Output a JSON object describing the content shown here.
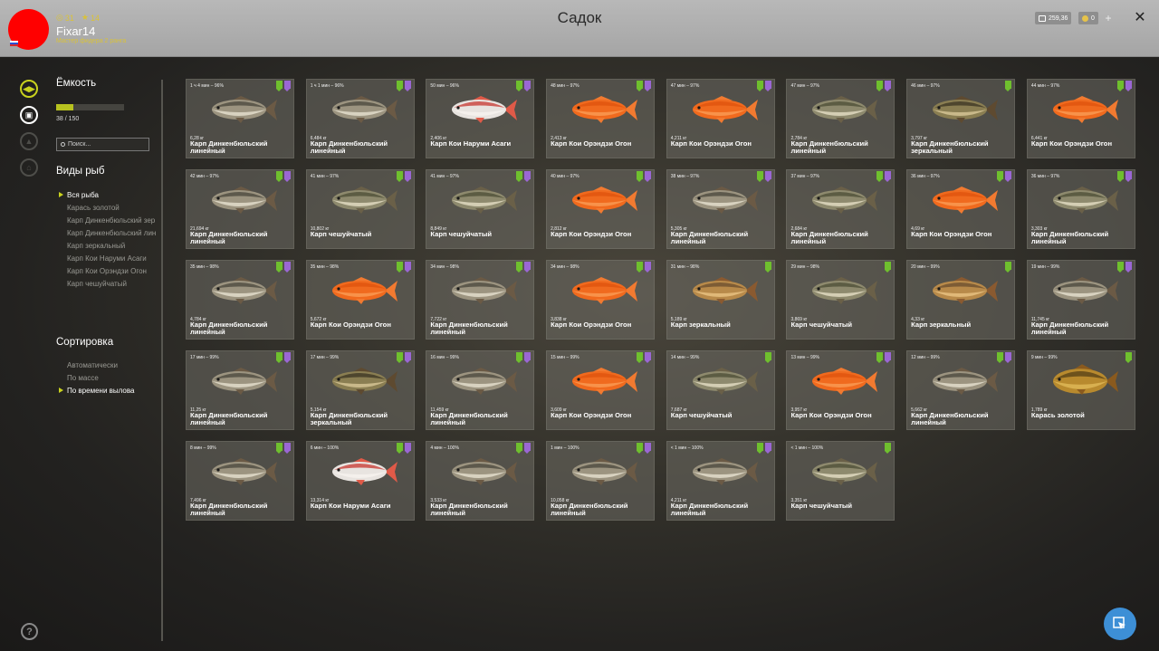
{
  "header": {
    "title": "Садок",
    "stat_coins": "31",
    "stat_stars": "14",
    "username": "Fixar14",
    "user_title": "Мастер фидера 2 ранга",
    "money": "259,36",
    "gold": "0",
    "plus": "+",
    "close": "✕"
  },
  "sidebar": {
    "capacity_label": "Ёмкость",
    "capacity_text": "38 / 150",
    "capacity_fraction": 0.253,
    "search_placeholder": "Поиск...",
    "species_label": "Виды рыб",
    "species": [
      "Вся рыба",
      "Карась золотой",
      "Карп Динкенбюльский зер",
      "Карп Динкенбюльский лин",
      "Карп зеркальный",
      "Карп Кои Наруми Асаги",
      "Карп Кои Орэндзи Огон",
      "Карп чешуйчатый"
    ],
    "species_selected": 0,
    "sort_label": "Сортировка",
    "sort_options": [
      "Автоматически",
      "По массе",
      "По времени вылова"
    ],
    "sort_selected": 2
  },
  "colors": {
    "accent": "#c9d21e",
    "badge_green": "#6fbf2e",
    "badge_purple": "#9a67d4"
  },
  "fish": [
    {
      "time": "1 ч 4 мин – 96%",
      "weight": "6,28 кг",
      "name": "Карп Динкенбюльский линейный",
      "type": "carp",
      "badges": [
        "g",
        "p"
      ]
    },
    {
      "time": "1 ч 1 мин – 96%",
      "weight": "6,484 кг",
      "name": "Карп Динкенбюльский линейный",
      "type": "carp",
      "badges": [
        "g",
        "p"
      ]
    },
    {
      "time": "50 мин – 96%",
      "weight": "2,406 кг",
      "name": "Карп Кои Наруми Асаги",
      "type": "koi_asagi",
      "badges": [
        "g",
        "p"
      ]
    },
    {
      "time": "48 мин – 97%",
      "weight": "2,413 кг",
      "name": "Карп Кои Орэндзи Огон",
      "type": "koi_orange",
      "badges": [
        "g",
        "p"
      ]
    },
    {
      "time": "47 мин – 97%",
      "weight": "4,211 кг",
      "name": "Карп Кои Орэндзи Огон",
      "type": "koi_orange",
      "badges": [
        "g",
        "p"
      ]
    },
    {
      "time": "47 мин – 97%",
      "weight": "2,784 кг",
      "name": "Карп Динкенбюльский линейный",
      "type": "carp_scaled",
      "badges": [
        "g",
        "p"
      ]
    },
    {
      "time": "46 мин – 97%",
      "weight": "3,797 кг",
      "name": "Карп Динкенбюльский зеркальный",
      "type": "carp_mirror",
      "badges": [
        "g"
      ]
    },
    {
      "time": "44 мин – 97%",
      "weight": "6,441 кг",
      "name": "Карп Кои Орэндзи Огон",
      "type": "koi_orange",
      "badges": [
        "g",
        "p"
      ]
    },
    {
      "time": "42 мин – 97%",
      "weight": "21,694 кг",
      "name": "Карп Динкенбюльский линейный",
      "type": "carp",
      "badges": [
        "g",
        "p"
      ]
    },
    {
      "time": "41 мин – 97%",
      "weight": "10,802 кг",
      "name": "Карп чешуйчатый",
      "type": "carp_scaled",
      "badges": [
        "g",
        "p"
      ]
    },
    {
      "time": "41 мин – 97%",
      "weight": "8,849 кг",
      "name": "Карп чешуйчатый",
      "type": "carp_scaled",
      "badges": [
        "g",
        "p"
      ]
    },
    {
      "time": "40 мин – 97%",
      "weight": "2,812 кг",
      "name": "Карп Кои Орэндзи Огон",
      "type": "koi_orange",
      "badges": [
        "g",
        "p"
      ]
    },
    {
      "time": "38 мин – 97%",
      "weight": "5,305 кг",
      "name": "Карп Динкенбюльский линейный",
      "type": "carp",
      "badges": [
        "g",
        "p"
      ]
    },
    {
      "time": "37 мин – 97%",
      "weight": "2,684 кг",
      "name": "Карп Динкенбюльский линейный",
      "type": "carp_scaled",
      "badges": [
        "g",
        "p"
      ]
    },
    {
      "time": "36 мин – 97%",
      "weight": "4,69 кг",
      "name": "Карп Кои Орэндзи Огон",
      "type": "koi_orange",
      "badges": [
        "g",
        "p"
      ]
    },
    {
      "time": "36 мин – 97%",
      "weight": "3,303 кг",
      "name": "Карп Динкенбюльский линейный",
      "type": "carp_scaled",
      "badges": [
        "g",
        "p"
      ]
    },
    {
      "time": "35 мин – 98%",
      "weight": "4,784 кг",
      "name": "Карп Динкенбюльский линейный",
      "type": "carp",
      "badges": [
        "g",
        "p"
      ]
    },
    {
      "time": "35 мин – 98%",
      "weight": "5,672 кг",
      "name": "Карп Кои Орэндзи Огон",
      "type": "koi_orange",
      "badges": [
        "g",
        "p"
      ]
    },
    {
      "time": "34 мин – 98%",
      "weight": "7,722 кг",
      "name": "Карп Динкенбюльский линейный",
      "type": "carp",
      "badges": [
        "g",
        "p"
      ]
    },
    {
      "time": "34 мин – 98%",
      "weight": "3,838 кг",
      "name": "Карп Кои Орэндзи Огон",
      "type": "koi_orange",
      "badges": [
        "g",
        "p"
      ]
    },
    {
      "time": "31 мин – 98%",
      "weight": "5,189 кг",
      "name": "Карп зеркальный",
      "type": "carp_golden",
      "badges": [
        "g"
      ]
    },
    {
      "time": "29 мин – 98%",
      "weight": "3,869 кг",
      "name": "Карп чешуйчатый",
      "type": "carp_scaled",
      "badges": [
        "g"
      ]
    },
    {
      "time": "20 мин – 99%",
      "weight": "4,33 кг",
      "name": "Карп зеркальный",
      "type": "carp_golden",
      "badges": [
        "g"
      ]
    },
    {
      "time": "19 мин – 99%",
      "weight": "11,745 кг",
      "name": "Карп Динкенбюльский линейный",
      "type": "carp",
      "badges": [
        "g",
        "p"
      ]
    },
    {
      "time": "17 мин – 99%",
      "weight": "11,25 кг",
      "name": "Карп Динкенбюльский линейный",
      "type": "carp",
      "badges": [
        "g",
        "p"
      ]
    },
    {
      "time": "17 мин – 99%",
      "weight": "5,154 кг",
      "name": "Карп Динкенбюльский зеркальный",
      "type": "carp_mirror",
      "badges": [
        "g",
        "p"
      ]
    },
    {
      "time": "16 мин – 99%",
      "weight": "11,459 кг",
      "name": "Карп Динкенбюльский линейный",
      "type": "carp",
      "badges": [
        "g",
        "p"
      ]
    },
    {
      "time": "15 мин – 99%",
      "weight": "3,609 кг",
      "name": "Карп Кои Орэндзи Огон",
      "type": "koi_orange",
      "badges": [
        "g",
        "p"
      ]
    },
    {
      "time": "14 мин – 99%",
      "weight": "7,687 кг",
      "name": "Карп чешуйчатый",
      "type": "carp_scaled",
      "badges": [
        "g"
      ]
    },
    {
      "time": "13 мин – 99%",
      "weight": "3,957 кг",
      "name": "Карп Кои Орэндзи Огон",
      "type": "koi_orange",
      "badges": [
        "g",
        "p"
      ]
    },
    {
      "time": "12 мин – 99%",
      "weight": "5,662 кг",
      "name": "Карп Динкенбюльский линейный",
      "type": "carp",
      "badges": [
        "g",
        "p"
      ]
    },
    {
      "time": "9 мин – 99%",
      "weight": "1,789 кг",
      "name": "Карась золотой",
      "type": "crucian",
      "badges": [
        "g"
      ]
    },
    {
      "time": "8 мин – 99%",
      "weight": "7,496 кг",
      "name": "Карп Динкенбюльский линейный",
      "type": "carp",
      "badges": [
        "g",
        "p"
      ]
    },
    {
      "time": "6 мин – 100%",
      "weight": "13,314 кг",
      "name": "Карп Кои Наруми Асаги",
      "type": "koi_asagi",
      "badges": [
        "g",
        "p"
      ]
    },
    {
      "time": "4 мин – 100%",
      "weight": "3,533 кг",
      "name": "Карп Динкенбюльский линейный",
      "type": "carp",
      "badges": [
        "g",
        "p"
      ]
    },
    {
      "time": "1 мин – 100%",
      "weight": "10,058 кг",
      "name": "Карп Динкенбюльский линейный",
      "type": "carp",
      "badges": [
        "g",
        "p"
      ]
    },
    {
      "time": "< 1 мин – 100%",
      "weight": "4,211 кг",
      "name": "Карп Динкенбюльский линейный",
      "type": "carp",
      "badges": [
        "g",
        "p"
      ]
    },
    {
      "time": "< 1 мин – 100%",
      "weight": "3,351 кг",
      "name": "Карп чешуйчатый",
      "type": "carp_scaled",
      "badges": [
        "g"
      ]
    }
  ]
}
